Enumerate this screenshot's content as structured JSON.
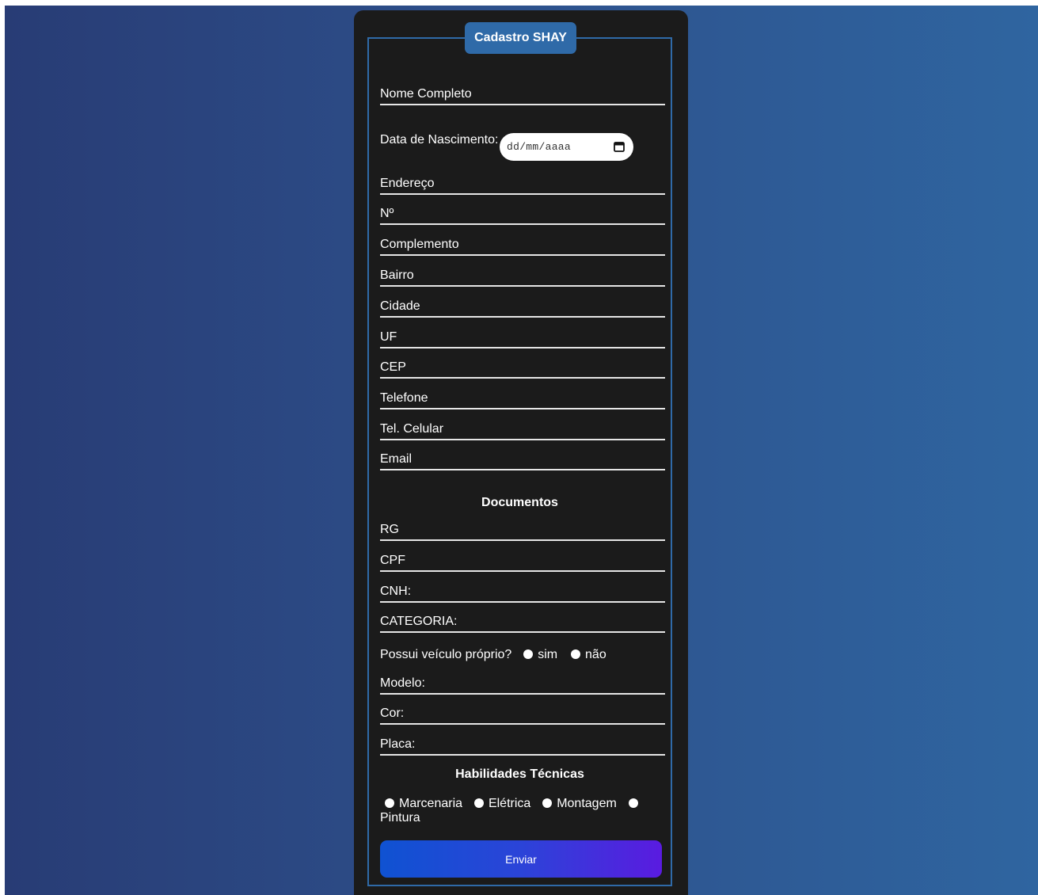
{
  "form": {
    "title": "Cadastro SHAY",
    "fields": {
      "nome": "Nome Completo",
      "nascimento": "Data de Nascimento:",
      "endereco": "Endereço",
      "numero": "Nº",
      "complemento": "Complemento",
      "bairro": "Bairro",
      "cidade": "Cidade",
      "uf": "UF",
      "cep": "CEP",
      "telefone": "Telefone",
      "celular": "Tel. Celular",
      "email": "Email",
      "rg": "RG",
      "cpf": "CPF",
      "cnh": "CNH:",
      "categoria": "CATEGORIA:",
      "modelo": "Modelo:",
      "cor": "Cor:",
      "placa": "Placa:"
    },
    "date_placeholder": "dd/mm/aaaa",
    "documentos_title": "Documentos",
    "veiculo_question": "Possui veículo próprio?",
    "veiculo_options": [
      "sim",
      "não"
    ],
    "habilidades_title": "Habilidades Técnicas",
    "habilidades": [
      "Marcenaria",
      "Elétrica",
      "Montagem",
      "Pintura"
    ],
    "submit_label": "Enviar"
  },
  "colors": {
    "card_bg": "#1b1b1b",
    "accent": "#2f6aa8",
    "button_start": "#0f52d2",
    "button_end": "#5a1be0"
  }
}
